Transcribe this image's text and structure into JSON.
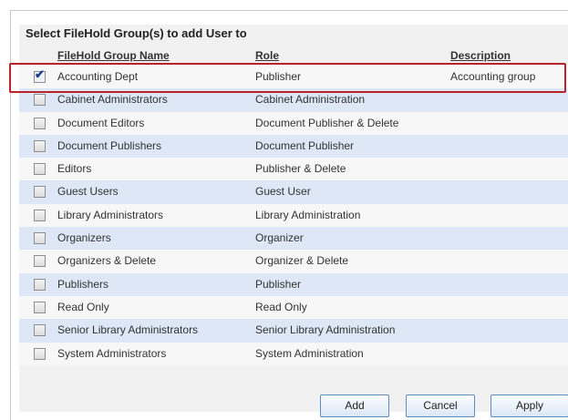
{
  "panel": {
    "title": "Select FileHold Group(s) to add User to"
  },
  "columns": {
    "name": "FileHold Group Name",
    "role": "Role",
    "description": "Description"
  },
  "rows": [
    {
      "name": "Accounting Dept",
      "role": "Publisher",
      "description": "Accounting group",
      "checked": true
    },
    {
      "name": "Cabinet Administrators",
      "role": "Cabinet Administration",
      "description": "",
      "checked": false
    },
    {
      "name": "Document Editors",
      "role": "Document Publisher & Delete",
      "description": "",
      "checked": false
    },
    {
      "name": "Document Publishers",
      "role": "Document Publisher",
      "description": "",
      "checked": false
    },
    {
      "name": "Editors",
      "role": "Publisher & Delete",
      "description": "",
      "checked": false
    },
    {
      "name": "Guest Users",
      "role": "Guest User",
      "description": "",
      "checked": false
    },
    {
      "name": "Library Administrators",
      "role": "Library Administration",
      "description": "",
      "checked": false
    },
    {
      "name": "Organizers",
      "role": "Organizer",
      "description": "",
      "checked": false
    },
    {
      "name": "Organizers & Delete",
      "role": "Organizer & Delete",
      "description": "",
      "checked": false
    },
    {
      "name": "Publishers",
      "role": "Publisher",
      "description": "",
      "checked": false
    },
    {
      "name": "Read Only",
      "role": "Read Only",
      "description": "",
      "checked": false
    },
    {
      "name": "Senior Library Administrators",
      "role": "Senior Library Administration",
      "description": "",
      "checked": false
    },
    {
      "name": "System Administrators",
      "role": "System Administration",
      "description": "",
      "checked": false
    }
  ],
  "buttons": {
    "add": "Add",
    "cancel": "Cancel",
    "apply": "Apply"
  },
  "colors": {
    "row_alt": "#dde7f5",
    "highlight_border": "#b8242a",
    "button_border": "#5e8bc1"
  }
}
